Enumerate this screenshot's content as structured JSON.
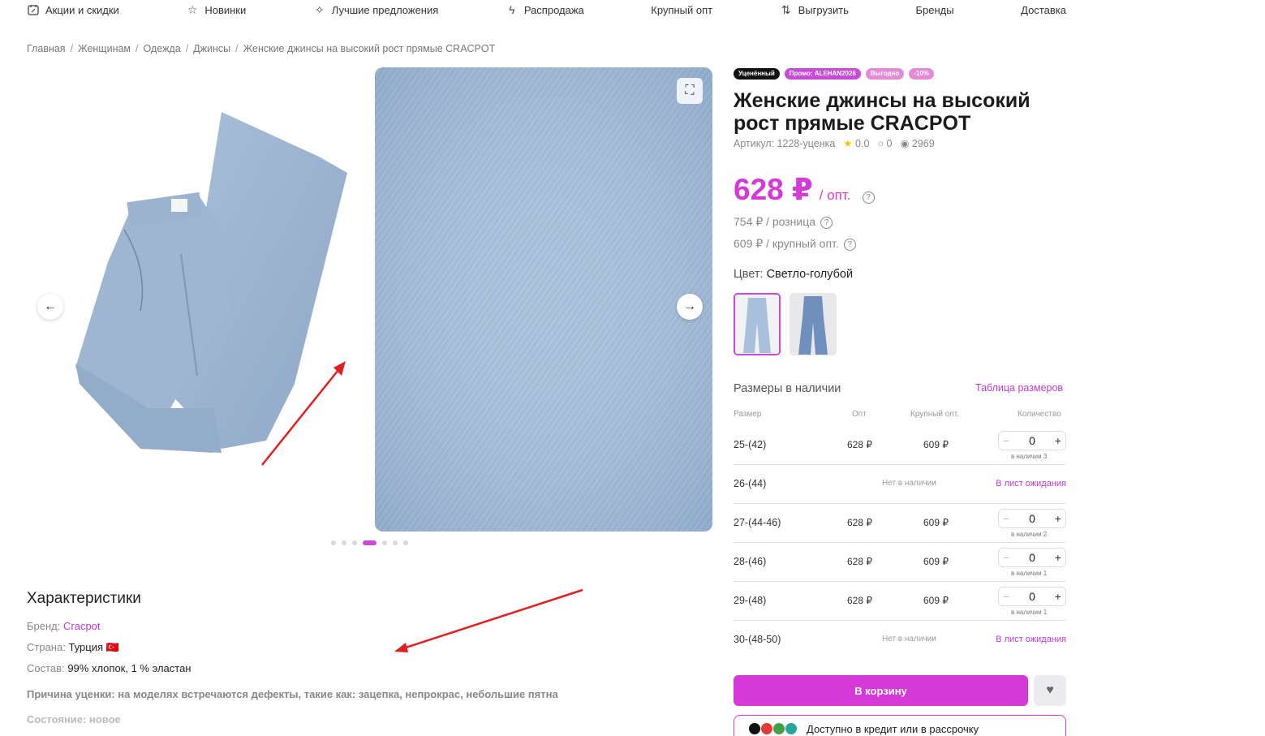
{
  "nav": [
    {
      "icon": "calendar-percent-icon",
      "label": "Акции и скидки"
    },
    {
      "icon": "star-icon",
      "label": "Новинки"
    },
    {
      "icon": "sparkle-icon",
      "label": "Лучшие предложения"
    },
    {
      "icon": "lightning-icon",
      "label": "Распродажа"
    },
    {
      "icon": "",
      "label": "Крупный опт"
    },
    {
      "icon": "export-icon",
      "label": "Выгрузить"
    },
    {
      "icon": "",
      "label": "Бренды"
    },
    {
      "icon": "",
      "label": "Доставка"
    }
  ],
  "breadcrumb": [
    "Главная",
    "Женщинам",
    "Одежда",
    "Джинсы",
    "Женские джинсы на высокий рост прямые CRACPOT"
  ],
  "gallery": {
    "dot_count": 7,
    "active_dot": 3
  },
  "badges": [
    {
      "label": "Уценённый",
      "color": "#111111"
    },
    {
      "label": "Промо: ALEHAN2026",
      "color": "#c84ad6"
    },
    {
      "label": "Выгодно",
      "color": "#e58ad8"
    },
    {
      "label": "-10%",
      "color": "#e58ad8"
    }
  ],
  "product": {
    "title": "Женские джинсы на высокий рост прямые CRACPOT",
    "article": "Артикул: 1228-уценка",
    "rating": "0.0",
    "comments": "0",
    "views": "2969",
    "price_main": "628 ₽",
    "price_unit": "/ опт.",
    "price_retail": "754 ₽ / розница",
    "price_bulk": "609 ₽ / крупный опт.",
    "color_label": "Цвет:",
    "color_value": "Светло-голубой"
  },
  "sizes": {
    "title": "Размеры в наличии",
    "table_link": "Таблица размеров",
    "headers": {
      "size": "Размер",
      "opt": "Опт",
      "kopt": "Крупный опт.",
      "qty": "Количество"
    },
    "rows": [
      {
        "size": "25-(42)",
        "opt": "628 ₽",
        "kopt": "609 ₽",
        "qty": "0",
        "avail": "в наличии 3"
      },
      {
        "size": "26-(44)",
        "na": "Нет в наличии",
        "wait": "В лист ожидания"
      },
      {
        "size": "27-(44-46)",
        "opt": "628 ₽",
        "kopt": "609 ₽",
        "qty": "0",
        "avail": "в наличии 2"
      },
      {
        "size": "28-(46)",
        "opt": "628 ₽",
        "kopt": "609 ₽",
        "qty": "0",
        "avail": "в наличии 1"
      },
      {
        "size": "29-(48)",
        "opt": "628 ₽",
        "kopt": "609 ₽",
        "qty": "0",
        "avail": "в наличии 1"
      },
      {
        "size": "30-(48-50)",
        "na": "Нет в наличии",
        "wait": "В лист ожидания"
      }
    ]
  },
  "actions": {
    "cart": "В корзину",
    "credit": "Доступно в кредит или в рассрочку"
  },
  "characteristics": {
    "title": "Характеристики",
    "brand_label": "Бренд:",
    "brand": "Cracpot",
    "country_label": "Страна:",
    "country": "Турция 🇹🇷",
    "composition_label": "Состав:",
    "composition": "99% хлопок, 1 % эластан",
    "defect": "Причина уценки: на моделях встречаются дефекты, такие как: зацепка, непрокрас, небольшие пятна",
    "condition": "Состояние: новое"
  }
}
